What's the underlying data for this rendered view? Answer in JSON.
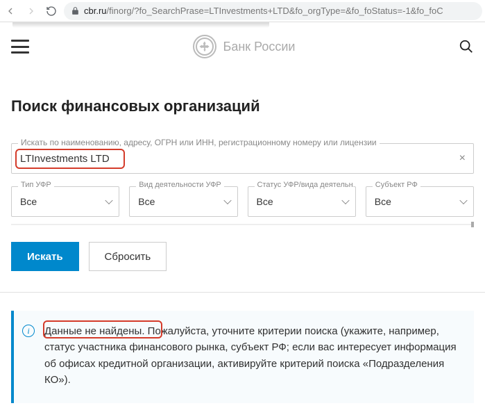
{
  "browser": {
    "url_host": "cbr.ru",
    "url_path": "/finorg/?fo_SearchPrase=LTInvestments+LTD&fo_orgType=&fo_foStatus=-1&fo_foC"
  },
  "header": {
    "brand": "Банк России"
  },
  "page": {
    "title": "Поиск финансовых организаций"
  },
  "search": {
    "label": "Искать по наименованию, адресу, ОГРН или ИНН, регистрационному номеру или лицензии",
    "value": "LTInvestments LTD"
  },
  "filters": [
    {
      "label": "Тип УФР",
      "value": "Все"
    },
    {
      "label": "Вид деятельности УФР",
      "value": "Все"
    },
    {
      "label": "Статус УФР/вида деятельности",
      "value": "Все"
    },
    {
      "label": "Субъект РФ",
      "value": "Все"
    }
  ],
  "buttons": {
    "search": "Искать",
    "reset": "Сбросить"
  },
  "info": {
    "bold": "Данные не найдены.",
    "rest": " Пожалуйста, уточните критерии поиска (укажите, например, статус участника финансового рынка, субъект РФ; если вас интересует информация об офисах кредитной организации, активируйте критерий поиска «Подразделения КО»)."
  }
}
